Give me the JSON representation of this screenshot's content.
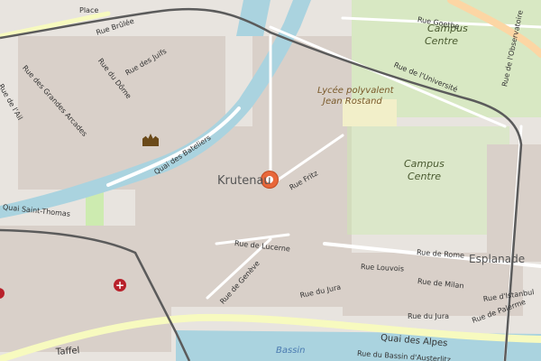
{
  "colors": {
    "background": "#e8e4df",
    "blocks": "#d9d0c9",
    "green": "#cdebb0",
    "water": "#aad3df",
    "primary_road": "#fcd6a4",
    "secondary_road": "#f7fabf",
    "rail": "#5b5b5b",
    "marker": "#e8673a"
  },
  "icons": [
    "location-marker-icon",
    "hospital-icon",
    "cathedral-icon"
  ],
  "place": {
    "name": "Krutenau"
  },
  "pois": [
    {
      "text": "Lycée polyvalent"
    },
    {
      "text": "Jean Rostand"
    }
  ],
  "campus": {
    "north": [
      "Campus",
      "Centre"
    ],
    "main": [
      "Campus",
      "Centre"
    ]
  },
  "districts": {
    "esplanade": "Esplanade"
  },
  "water_labels": {
    "bassin": "Bassin"
  },
  "streets": [
    "Place",
    "Rue Brûlée",
    "Rue des Juifs",
    "Rue du Dôme",
    "Rue des Grandes Arcades",
    "Rue de l'Ail",
    "Quai des Bateliers",
    "Quai Saint-Thomas",
    "Rue de Lucerne",
    "Rue de Genève",
    "Rue du Jura",
    "Rue Fritz",
    "Rue Goethe",
    "Rue de l'Université",
    "Rue de l'Observatoire",
    "Rue Louvois",
    "Rue de Rome",
    "Rue de Milan",
    "Rue d'Istanbul",
    "Quai des Alpes",
    "Rue du Bassin d'Austerlitz",
    "Rue du Jura",
    "Rue de Palerme",
    "Taffel"
  ]
}
